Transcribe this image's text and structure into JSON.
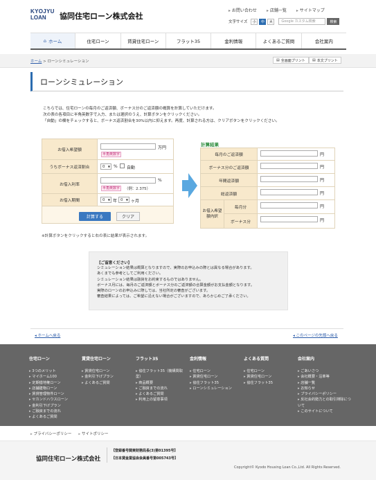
{
  "header": {
    "logo_line1": "KYOJYU",
    "logo_line2": "LOAN",
    "company": "協同住宅ローン株式会社",
    "top_links": [
      "お問い合わせ",
      "店舗一覧",
      "サイトマップ"
    ],
    "text_size_label": "文字サイズ",
    "text_size_options": [
      "小",
      "中",
      "大"
    ],
    "search_placeholder": "Google カスタム検索",
    "search_button": "検索"
  },
  "nav": [
    "ホーム",
    "住宅ローン",
    "賃貸住宅ローン",
    "フラット35",
    "金利情報",
    "よくあるご質問",
    "会社案内"
  ],
  "breadcrumb": {
    "home": "ホーム",
    "separator": " > ",
    "current": "ローンシミュレーション"
  },
  "print": {
    "all": "全画面プリント",
    "body": "本文プリント"
  },
  "page_title": "ローンシミュレーション",
  "intro": [
    "こちらでは、住宅ローンの毎月のご返済額、ボーナス分のご返済額の概算を計算していただけます。",
    "次の表の各項目に半角英数字で入力、または選択のうえ、計算ボタンをクリックください。",
    "「自動」の欄をチェックすると、ボーナス返済割合を30%以内に抑えます。再度、計算される方は、クリアボタンをクリックください。"
  ],
  "form": {
    "amount_label": "お借入希望額",
    "amount_unit": "万円",
    "halfwidth_note": "半角英数字",
    "bonus_label": "うちボーナス返済割合",
    "bonus_value": "0",
    "bonus_unit": "%",
    "auto_label": "自動",
    "rate_label": "お借入利率",
    "rate_unit": "%",
    "rate_example": "（例：2.375）",
    "term_label": "お借入期間",
    "term_years": "0",
    "term_years_unit": "年",
    "term_months": "0",
    "term_months_unit": "ヶ月",
    "calc_button": "計算する",
    "clear_button": "クリア",
    "note": "※計算ボタンをクリックすると右の表に結果が表示されます。"
  },
  "result": {
    "title": "計算結果",
    "rows": [
      "毎月のご返済額",
      "ボーナス分のご返済額",
      "年間返済額",
      "総返済額"
    ],
    "breakdown_label": "お借入希望額内訳",
    "breakdown_rows": [
      "毎月分",
      "ボーナス分"
    ],
    "unit": "円"
  },
  "caution": {
    "title": "【ご留意ください】",
    "lines": [
      "シミュレーション結果は概算となりますので、実際のお申込みの際とは異なる場合があります。",
      "あくまでも参考としてご利用ください。",
      "シミュレーション結果は融資をお約束するものではありません。",
      "ボーナス月には、毎月のご返済額とボーナス分のご返済額の合算金額がお支払金額となります。",
      "実際のローンのお申込みに際しては、当社所定の審査がございます。",
      "審査結果によっては、ご希望に沿えない場合がございますので、あらかじめご了承ください。"
    ]
  },
  "bottom_links": {
    "home": "ホームへ戻る",
    "page_top": "このページの先頭へ戻る"
  },
  "footer": {
    "columns": [
      {
        "heading": "住宅ローン",
        "items": [
          "3つのメリット",
          "マイホーム100",
          "定期借地権ローン",
          "店舗建物ローン",
          "賃貸管理物件ローン",
          "セカンドハウスローン",
          "金利引下げプラン",
          "ご融資までの流れ",
          "よくあるご質問"
        ]
      },
      {
        "heading": "賃貸住宅ローン",
        "items": [
          "賃貸住宅ローン",
          "金利引下げプラン",
          "よくあるご質問"
        ]
      },
      {
        "heading": "フラット35",
        "items": [
          "協住フラット35（機構買取型）",
          "商品概要",
          "ご融資までの流れ",
          "よくあるご質問",
          "利用上の留意事項"
        ]
      },
      {
        "heading": "金利情報",
        "items": [
          "住宅ローン",
          "賃貸住宅ローン",
          "協住フラット35",
          "ローンシミュレーション"
        ]
      },
      {
        "heading": "よくある質問",
        "items": [
          "住宅ローン",
          "賃貸住宅ローン",
          "協住フラット35"
        ]
      },
      {
        "heading": "会社案内",
        "items": [
          "ごあいさつ",
          "会社概要・沿革等",
          "店舗一覧",
          "お知らせ",
          "プライバシーポリシー",
          "反社会的勢力との取引排除について",
          "このサイトについて"
        ]
      }
    ],
    "policy_links": [
      "プライバシーポリシー",
      "サイトポリシー"
    ],
    "company": "協同住宅ローン株式会社",
    "registrations": [
      "【登録番号関東財務局長(3)第01395号】",
      "【日本貸金業協会会員番号第005743号】"
    ],
    "copyright": "Copyright© Kyodo Housing Loan Co.,Ltd. All Rights Reserved."
  }
}
